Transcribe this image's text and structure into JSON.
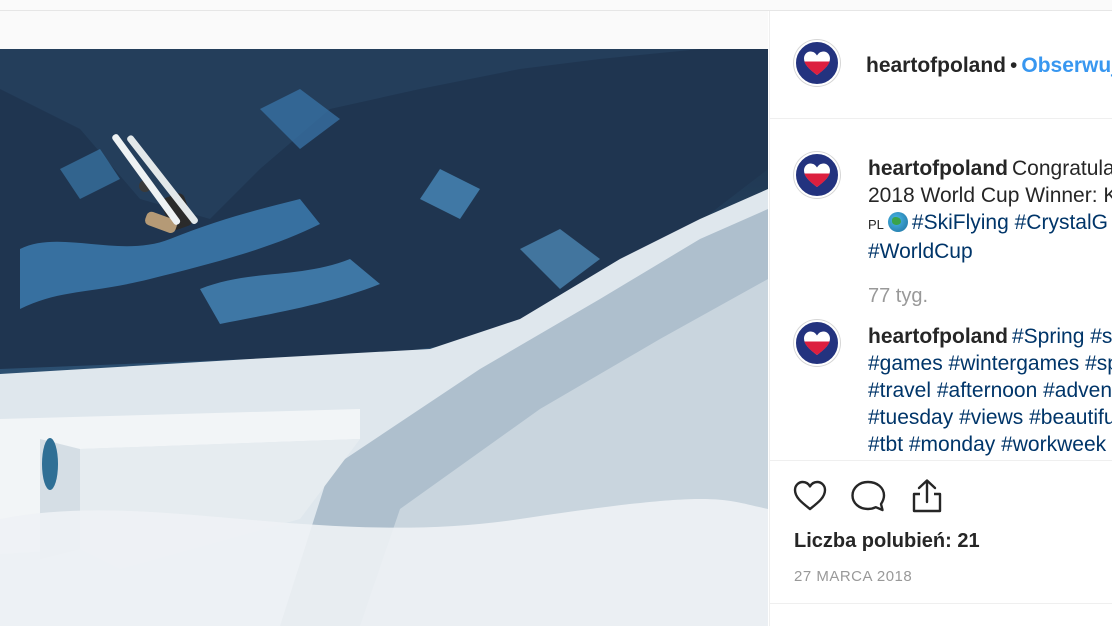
{
  "post": {
    "username": "heartofpoland",
    "follow_label": "Obserwuj",
    "dot": "•"
  },
  "comments": [
    {
      "username": "heartofpoland",
      "lines": [
        "Congratula",
        "2018 World Cup Winner: K",
        "#SkiFlying #CrystalG",
        "#WorldCup"
      ],
      "flag_text": "PL"
    },
    {
      "username": "heartofpoland",
      "lines": [
        "#Spring #sk",
        "#games #wintergames #sp",
        "#travel #afternoon #adven",
        "#tuesday #views #beautifu",
        "#tbt #monday #workweek"
      ]
    }
  ],
  "time_ago": "77 tyg.",
  "likes": "Liczba polubień: 21",
  "date": "27 MARCA 2018",
  "icons": [
    "heart-icon",
    "comment-icon",
    "share-icon"
  ],
  "colors": {
    "link": "#3897f0",
    "hashtag": "#003569",
    "muted": "#999999",
    "avatar_bg": "#23337f"
  }
}
